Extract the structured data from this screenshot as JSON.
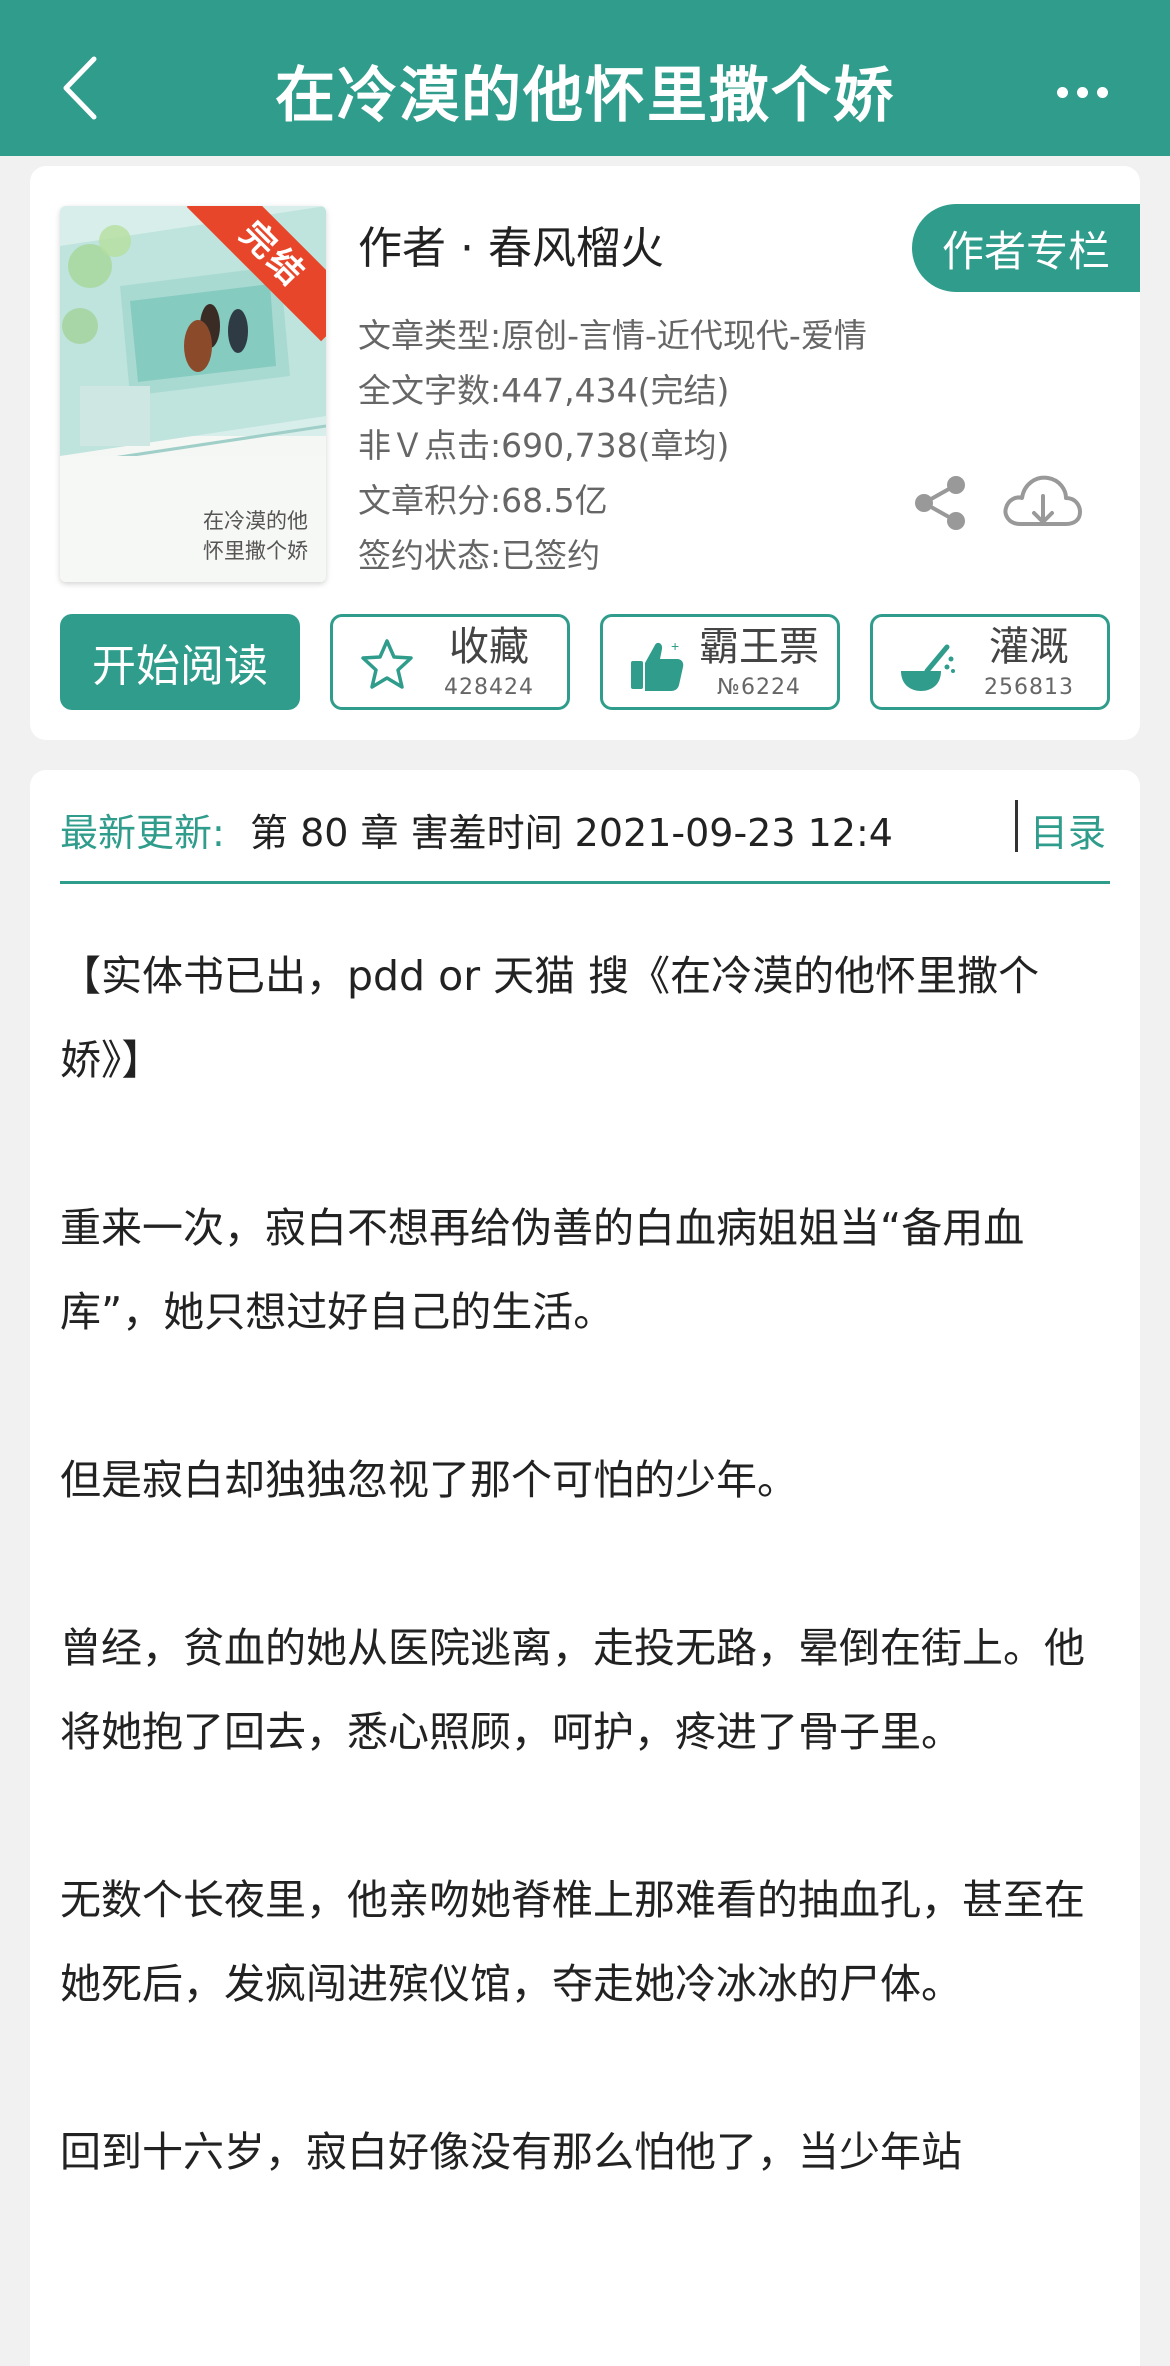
{
  "header": {
    "title": "在冷漠的他怀里撒个娇",
    "back_icon": "chevron-left-icon",
    "more_icon": "more-dots-icon"
  },
  "book": {
    "cover_badge": "完结",
    "cover_title": "在冷漠的他怀里撒个娇",
    "author": "作者 · 春风榴火",
    "author_column_label": "作者专栏",
    "meta": {
      "type": "文章类型:原创-言情-近代现代-爱情",
      "word_count": "全文字数:447,434(完结)",
      "non_vip_clicks": "非Ｖ点击:690,738(章均)",
      "score": "文章积分:68.5亿",
      "contract": "签约状态:已签约"
    }
  },
  "actions": {
    "read_label": "开始阅读",
    "favorite": {
      "label": "收藏",
      "count": "428424"
    },
    "overlord": {
      "label": "霸王票",
      "count": "№6224"
    },
    "irrigate": {
      "label": "灌溉",
      "count": "256813"
    }
  },
  "update": {
    "label": "最新更新:",
    "text": "第 80 章 害羞时间 2021-09-23 12:4",
    "toc_label": "目录"
  },
  "synopsis": [
    "【实体书已出，pdd or 天猫 搜《在冷漠的他怀里撒个娇》】",
    "重来一次，寂白不想再给伪善的白血病姐姐当“备用血库”，她只想过好自己的生活。",
    "但是寂白却独独忽视了那个可怕的少年。",
    "曾经，贫血的她从医院逃离，走投无路，晕倒在街上。他将她抱了回去，悉心照顾，呵护，疼进了骨子里。",
    "无数个长夜里，他亲吻她脊椎上那难看的抽血孔，甚至在她死后，发疯闯进殡仪馆，夺走她冷冰冰的尸体。",
    "回到十六岁，寂白好像没有那么怕他了，当少年站"
  ],
  "colors": {
    "accent": "#2f9c8c",
    "badge": "#e8462a",
    "background": "#f0f1f0"
  }
}
